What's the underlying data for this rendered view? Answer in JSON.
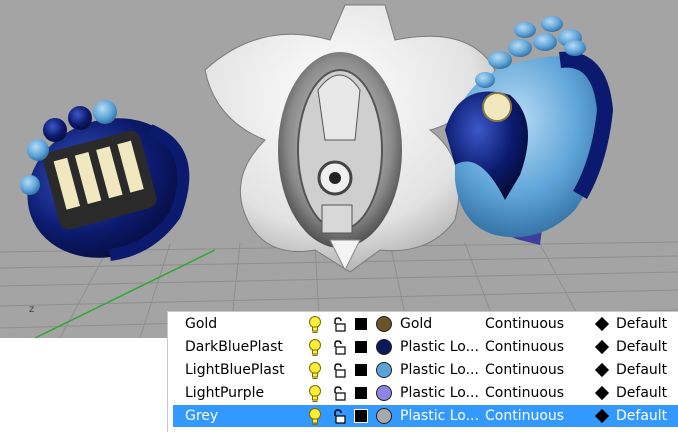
{
  "viewport": {
    "axis_label": "z"
  },
  "layers": [
    {
      "name": "Gold",
      "material": "Gold",
      "material_color": "#6b5228",
      "linetype": "Continuous",
      "print_width": "Default",
      "selected": false
    },
    {
      "name": "DarkBluePlast",
      "material": "Plastic Lo...",
      "material_color": "#0a1a5c",
      "linetype": "Continuous",
      "print_width": "Default",
      "selected": false
    },
    {
      "name": "LightBluePlast",
      "material": "Plastic Lo...",
      "material_color": "#5ba3d9",
      "linetype": "Continuous",
      "print_width": "Default",
      "selected": false
    },
    {
      "name": "LightPurple",
      "material": "Plastic Lo...",
      "material_color": "#8f84e6",
      "linetype": "Continuous",
      "print_width": "Default",
      "selected": false
    },
    {
      "name": "Grey",
      "material": "Plastic Lo...",
      "material_color": "#a8a8a8",
      "linetype": "Continuous",
      "print_width": "Default",
      "selected": true
    }
  ]
}
